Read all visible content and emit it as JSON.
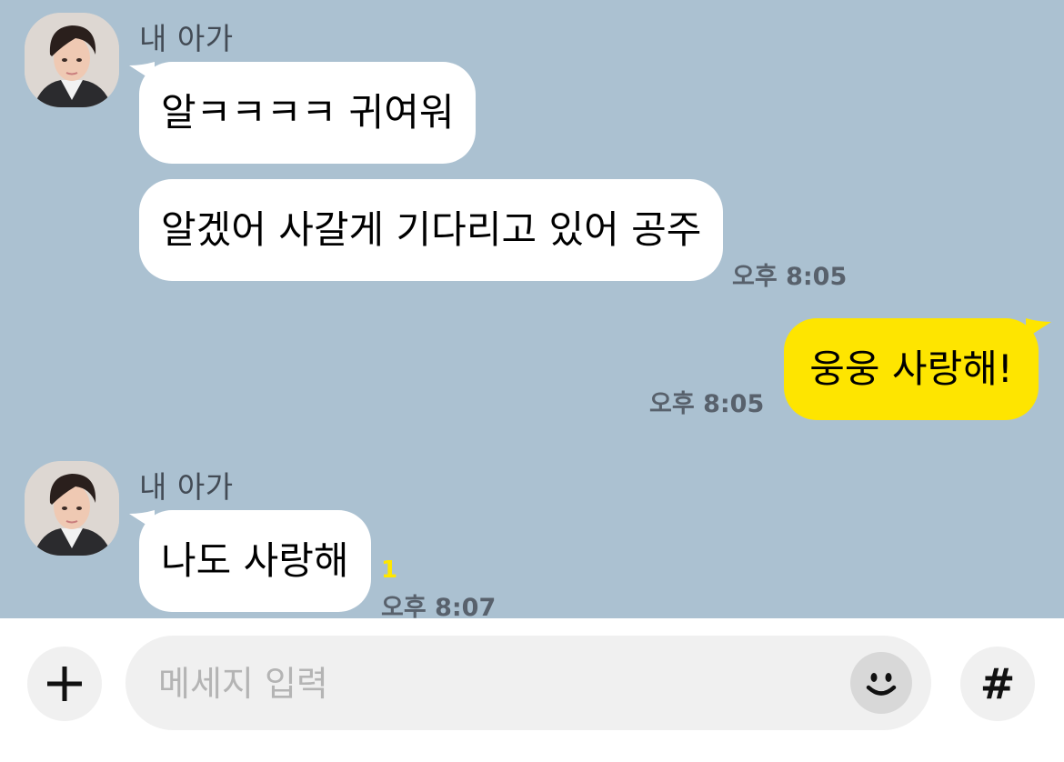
{
  "chat": {
    "background": "#abc1d1",
    "groups": [
      {
        "sender": "내 아가",
        "messages": [
          {
            "text": "알ㅋㅋㅋㅋ 귀여워"
          },
          {
            "text": "알겠어 사갈게 기다리고 있어 공주",
            "time": "오후 8:05"
          }
        ]
      },
      {
        "sender": "",
        "mine": true,
        "messages": [
          {
            "text": "웅웅 사랑해!",
            "time": "오후 8:05"
          }
        ]
      },
      {
        "sender": "내 아가",
        "messages": [
          {
            "text": "나도 사랑해",
            "unread": "1",
            "time": "오후 8:07"
          }
        ]
      }
    ]
  },
  "colors": {
    "incoming_bubble": "#ffffff",
    "outgoing_bubble": "#fee500",
    "unread_count": "#ffe700"
  },
  "input_bar": {
    "plus_icon": "plus-icon",
    "placeholder": "메세지 입력",
    "emoji_icon": "emoticon-icon",
    "hashtag_label": "#"
  }
}
